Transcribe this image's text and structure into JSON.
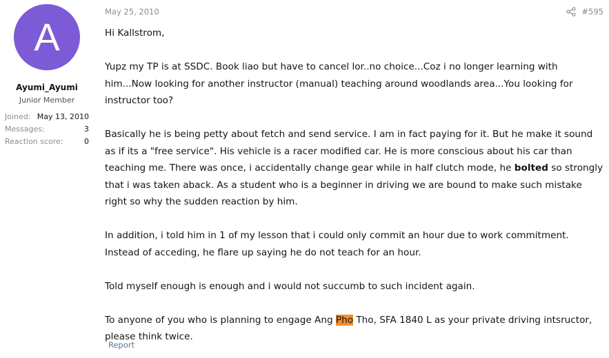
{
  "user": {
    "avatar_letter": "A",
    "avatar_color": "#7d5ad6",
    "name": "Ayumi_Ayumi",
    "title": "Junior Member",
    "stats": [
      {
        "label": "Joined:",
        "value": "May 13, 2010"
      },
      {
        "label": "Messages:",
        "value": "3"
      },
      {
        "label": "Reaction score:",
        "value": "0"
      }
    ]
  },
  "post": {
    "date": "May 25, 2010",
    "share_icon": "share-icon",
    "number": "#595",
    "greeting": "Hi Kallstrom,",
    "p1": "Yupz my TP is at SSDC. Book liao but have to cancel lor..no choice...Coz i no longer learning with him...Now looking for another instructor (manual) teaching around woodlands area...You looking for instructor too?",
    "p2_before": "Basically he is being petty about fetch and send service. I am in fact paying for it. But he make it sound as if its a \"free service\". His vehicle is a racer modified car. He is more conscious about his car than teaching me. There was once, i accidentally change gear while in half clutch mode, he ",
    "p2_bold": "bolted",
    "p2_after": " so strongly that i was taken aback. As a student who is a beginner in driving we are bound to make such mistake right so why the sudden reaction by him.",
    "p3": "In addition, i told him in 1 of my lesson that i could only commit an hour due to work commitment. Instead of acceding, he flare up saying he do not teach for an hour.",
    "p4": "Told myself enough is enough and i would not succumb to such incident again.",
    "p5_before": "To anyone of you who is planning to engage Ang ",
    "p5_highlight": "Pho",
    "p5_after": " Tho, SFA 1840 L as your private driving intsructor, please think twice.",
    "highlight_color": "#f58e2c",
    "report_label": "Report"
  }
}
